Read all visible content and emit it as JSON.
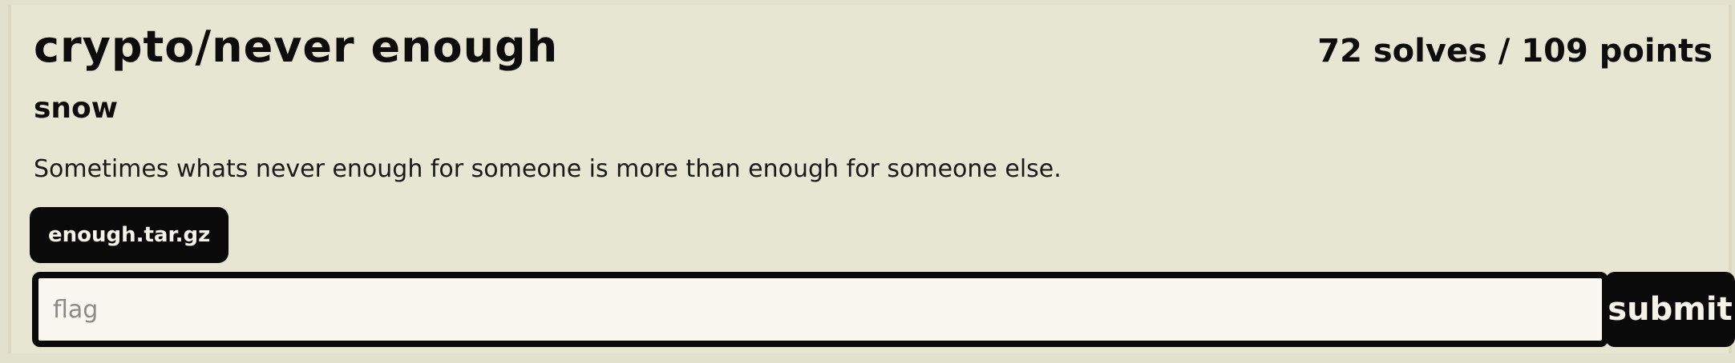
{
  "challenge": {
    "title": "crypto/never enough",
    "stats": "72 solves / 109 points",
    "author": "snow",
    "description": "Sometimes whats never enough for someone is more than enough for someone else."
  },
  "files": [
    {
      "label": "enough.tar.gz"
    }
  ],
  "flag_form": {
    "placeholder": "flag",
    "value": "",
    "submit_label": "submit"
  },
  "colors": {
    "background": "#e2e1cd",
    "card": "#e7e6d2",
    "button": "#0a0a0a",
    "input_background": "#f8f8f1"
  }
}
